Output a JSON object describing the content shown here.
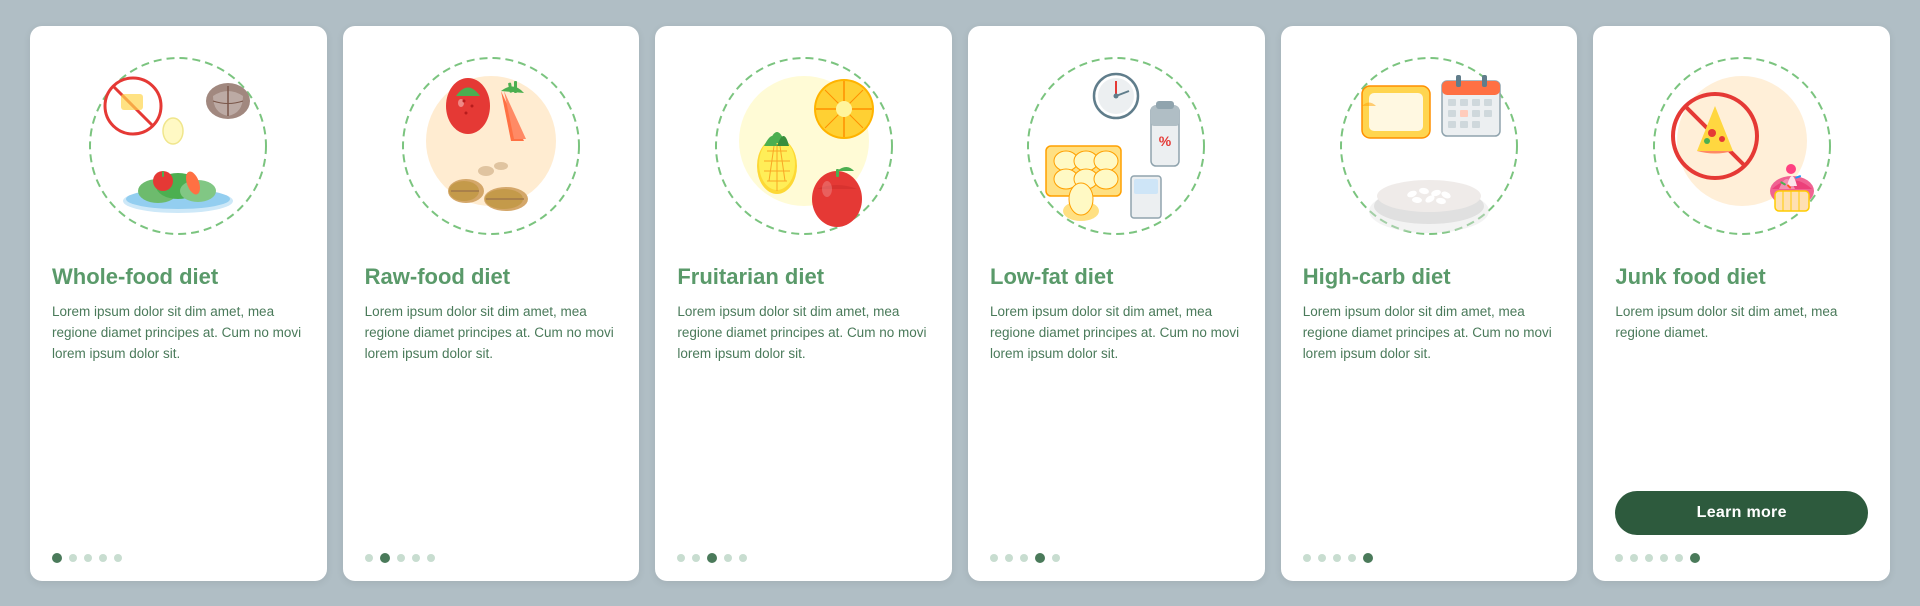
{
  "cards": [
    {
      "id": "whole-food",
      "title": "Whole-food diet",
      "body": "Lorem ipsum dolor sit dim amet, mea regione diamet principes at. Cum no movi lorem ipsum dolor sit.",
      "dots": [
        true,
        false,
        false,
        false,
        false
      ],
      "activeDot": 0,
      "icon": "whole-food-icon"
    },
    {
      "id": "raw-food",
      "title": "Raw-food diet",
      "body": "Lorem ipsum dolor sit dim amet, mea regione diamet principes at. Cum no movi lorem ipsum dolor sit.",
      "dots": [
        false,
        true,
        false,
        false,
        false
      ],
      "activeDot": 1,
      "icon": "raw-food-icon"
    },
    {
      "id": "fruitarian",
      "title": "Fruitarian diet",
      "body": "Lorem ipsum dolor sit dim amet, mea regione diamet principes at. Cum no movi lorem ipsum dolor sit.",
      "dots": [
        false,
        false,
        true,
        false,
        false
      ],
      "activeDot": 2,
      "icon": "fruitarian-icon"
    },
    {
      "id": "low-fat",
      "title": "Low-fat diet",
      "body": "Lorem ipsum dolor sit dim amet, mea regione diamet principes at. Cum no movi lorem ipsum dolor sit.",
      "dots": [
        false,
        false,
        false,
        true,
        false
      ],
      "activeDot": 3,
      "icon": "low-fat-icon"
    },
    {
      "id": "high-carb",
      "title": "High-carb diet",
      "body": "Lorem ipsum dolor sit dim amet, mea regione diamet principes at. Cum no movi lorem ipsum dolor sit.",
      "dots": [
        false,
        false,
        false,
        false,
        true
      ],
      "activeDot": 4,
      "icon": "high-carb-icon"
    },
    {
      "id": "junk-food",
      "title": "Junk food diet",
      "body": "Lorem ipsum dolor sit dim amet, mea regione diamet.",
      "dots": [
        false,
        false,
        false,
        false,
        false,
        true
      ],
      "activeDot": 5,
      "hasButton": true,
      "buttonLabel": "Learn more",
      "icon": "junk-food-icon"
    }
  ]
}
